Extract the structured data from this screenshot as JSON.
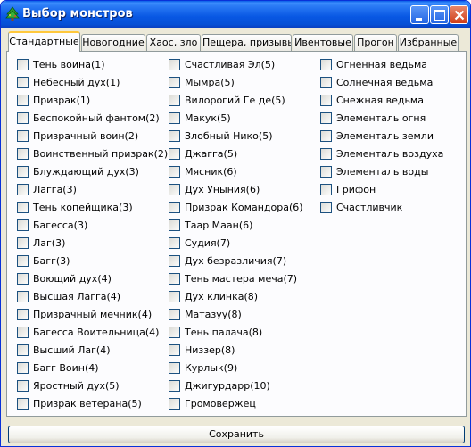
{
  "window": {
    "title": "Выбор монстров"
  },
  "tabs": [
    {
      "label": "Стандартные",
      "active": true
    },
    {
      "label": "Новогодние",
      "active": false
    },
    {
      "label": "Хаос, зло",
      "active": false
    },
    {
      "label": "Пещера, призывы",
      "active": false
    },
    {
      "label": "Ивентовые",
      "active": false
    },
    {
      "label": "Прогон",
      "active": false
    },
    {
      "label": "Избранные",
      "active": false
    }
  ],
  "monsters": {
    "column1": [
      "Тень воина(1)",
      "Небесный дух(1)",
      "Призрак(1)",
      "Беспокойный фантом(2)",
      "Призрачный воин(2)",
      "Воинственный призрак(2)",
      "Блуждающий дух(3)",
      "Лагга(3)",
      "Тень копейщика(3)",
      "Багесса(3)",
      "Лаг(3)",
      "Багг(3)",
      "Воющий дух(4)",
      "Высшая Лагга(4)",
      "Призрачный мечник(4)",
      "Багесса Воительница(4)",
      "Высший Лаг(4)",
      "Багг Воин(4)",
      "Яростный дух(5)",
      "Призрак ветерана(5)"
    ],
    "column2": [
      "Счастливая Эл(5)",
      "Мымра(5)",
      "Вилорогий Ге де(5)",
      "Макук(5)",
      "Злобный Нико(5)",
      "Джагга(5)",
      "Мясник(6)",
      "Дух Уныния(6)",
      "Призрак Командора(6)",
      "Таар Маан(6)",
      "Судия(7)",
      "Дух безразличия(7)",
      "Тень мастера меча(7)",
      "Дух клинка(8)",
      "Матазуу(8)",
      "Тень палача(8)",
      "Низзер(8)",
      "Курлык(9)",
      "Джигурдарр(10)",
      "Громовержец"
    ],
    "column3": [
      "Огненная ведьма",
      "Солнечная ведьма",
      "Снежная ведьма",
      "Элементаль огня",
      "Элементаль земли",
      "Элементаль воздуха",
      "Элементаль воды",
      "Грифон",
      "Счастливчик"
    ]
  },
  "footer": {
    "save_label": "Сохранить"
  }
}
